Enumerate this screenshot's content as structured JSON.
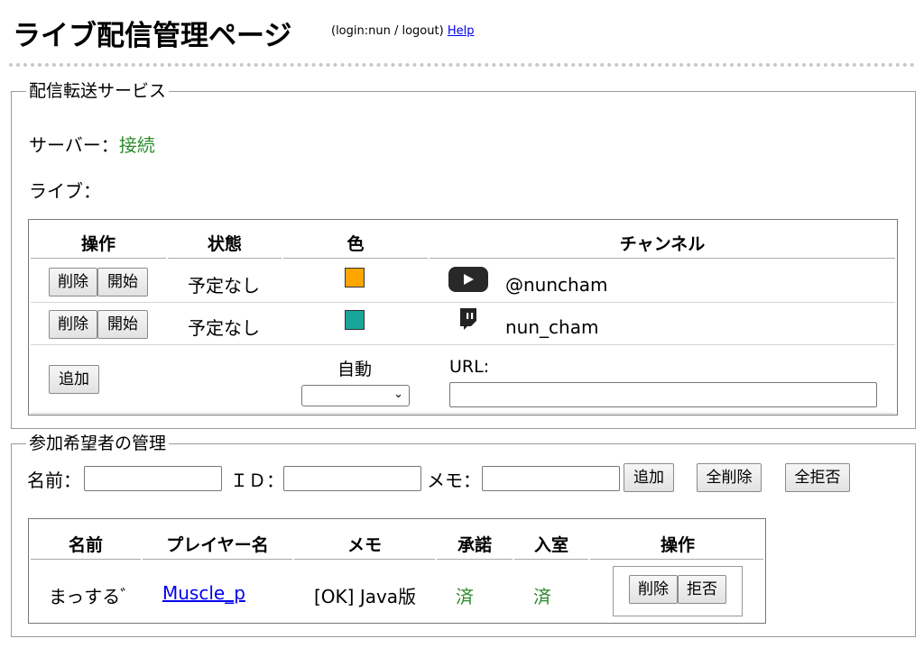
{
  "header": {
    "title": "ライブ配信管理ページ",
    "login_text": "(login:nun / logout)",
    "help_link": "Help"
  },
  "stream_service": {
    "legend": "配信転送サービス",
    "server_label": "サーバー：",
    "server_status": "接続",
    "live_label": "ライブ：",
    "table": {
      "headers": [
        "操作",
        "状態",
        "色",
        "チャンネル"
      ],
      "rows": [
        {
          "delete": "削除",
          "start": "開始",
          "status": "予定なし",
          "color": "#ffa500",
          "platform_icon": "youtube-icon",
          "channel": "@nuncham"
        },
        {
          "delete": "削除",
          "start": "開始",
          "status": "予定なし",
          "color": "#1aa59a",
          "platform_icon": "twitch-icon",
          "channel": "nun_cham"
        }
      ],
      "add_row": {
        "add_button": "追加",
        "auto_label": "自動",
        "auto_value": "",
        "url_label": "URL:",
        "url_value": ""
      }
    }
  },
  "participants": {
    "legend": "参加希望者の管理",
    "form": {
      "name_label": "名前：",
      "name_value": "",
      "id_label": "ＩＤ：",
      "id_value": "",
      "memo_label": "メモ：",
      "memo_value": "",
      "add_button": "追加",
      "delete_all_button": "全削除",
      "reject_all_button": "全拒否"
    },
    "table": {
      "headers": [
        "名前",
        "プレイヤー名",
        "メモ",
        "承諾",
        "入室",
        "操作"
      ],
      "rows": [
        {
          "name": "まっするﾞ",
          "player": "Muscle_p",
          "memo": "[OK] Java版",
          "approved": "済",
          "entered": "済",
          "delete": "削除",
          "reject": "拒否"
        }
      ]
    }
  },
  "colors": {
    "status_green": "#2a8a2a",
    "link": "#0000ee"
  }
}
